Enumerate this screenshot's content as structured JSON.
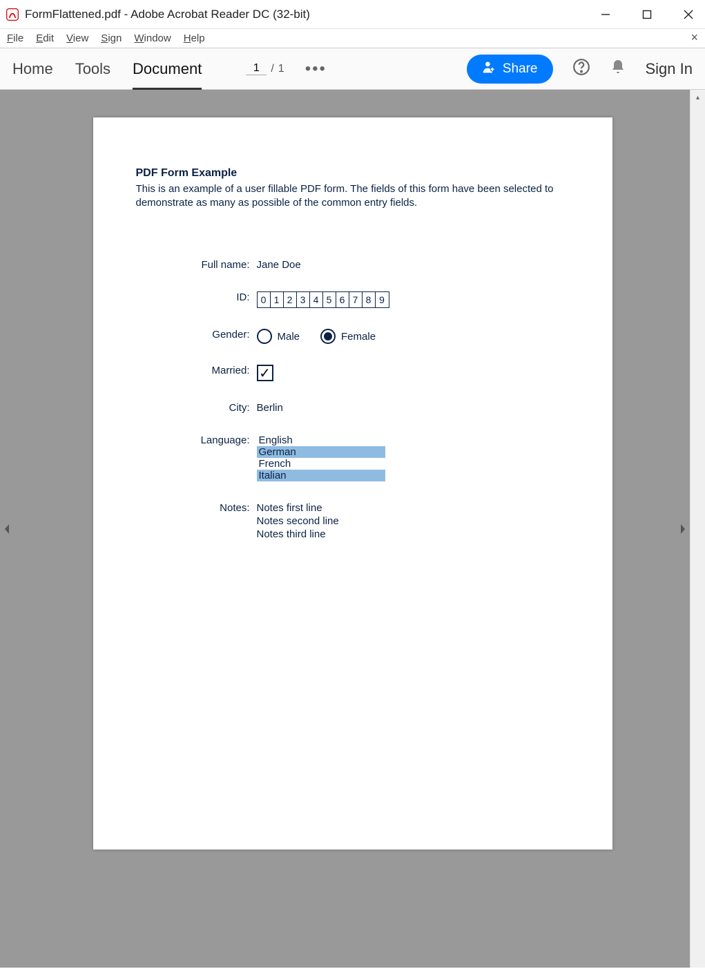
{
  "window": {
    "title": "FormFlattened.pdf - Adobe Acrobat Reader DC (32-bit)"
  },
  "menu": {
    "file": "File",
    "edit": "Edit",
    "view": "View",
    "sign": "Sign",
    "window": "Window",
    "help": "Help"
  },
  "toolbar": {
    "home": "Home",
    "tools": "Tools",
    "document": "Document",
    "page_current": "1",
    "page_sep": "/",
    "page_total": "1",
    "share": "Share",
    "signin": "Sign In"
  },
  "form": {
    "title": "PDF Form Example",
    "description": "This is an example of a user fillable PDF form. The fields of this form have been selected to demonstrate as many as possible of the common entry fields.",
    "labels": {
      "fullname": "Full name:",
      "id": "ID:",
      "gender": "Gender:",
      "married": "Married:",
      "city": "City:",
      "language": "Language:",
      "notes": "Notes:"
    },
    "fullname": "Jane Doe",
    "id_digits": [
      "0",
      "1",
      "2",
      "3",
      "4",
      "5",
      "6",
      "7",
      "8",
      "9"
    ],
    "gender_options": {
      "male": "Male",
      "female": "Female"
    },
    "gender_selected": "female",
    "married_checked": true,
    "city": "Berlin",
    "languages": [
      {
        "name": "English",
        "selected": false
      },
      {
        "name": "German",
        "selected": true
      },
      {
        "name": "French",
        "selected": false
      },
      {
        "name": "Italian",
        "selected": true
      }
    ],
    "notes": [
      "Notes first line",
      "Notes second line",
      "Notes third line"
    ]
  }
}
